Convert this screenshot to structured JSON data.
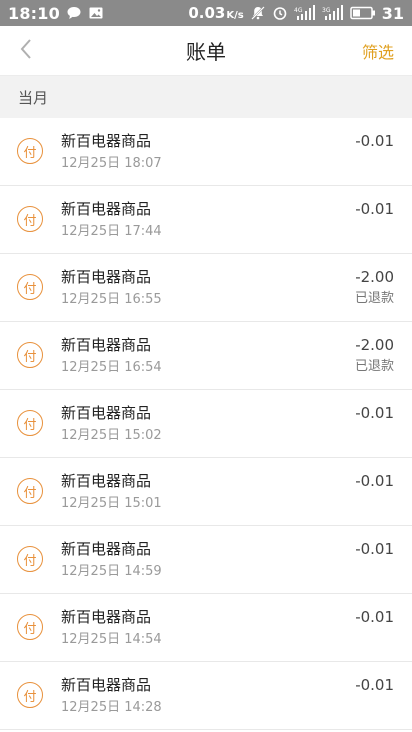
{
  "status_bar": {
    "time": "18:10",
    "net_speed": "0.03",
    "net_speed_unit": "K/s",
    "battery": "31",
    "icons": [
      "chat-bubble-icon",
      "image-icon",
      "mute-bell-icon",
      "alarm-clock-icon",
      "signal-4g-icon",
      "signal-3g-icon",
      "battery-icon"
    ]
  },
  "header": {
    "title": "账单",
    "filter_label": "筛选"
  },
  "section": {
    "label": "当月"
  },
  "accent": "#e8913c",
  "filter_color": "#e0a020",
  "transactions": [
    {
      "icon_char": "付",
      "name": "新百电器商品",
      "time": "12月25日 18:07",
      "amount": "-0.01",
      "status": ""
    },
    {
      "icon_char": "付",
      "name": "新百电器商品",
      "time": "12月25日 17:44",
      "amount": "-0.01",
      "status": ""
    },
    {
      "icon_char": "付",
      "name": "新百电器商品",
      "time": "12月25日 16:55",
      "amount": "-2.00",
      "status": "已退款"
    },
    {
      "icon_char": "付",
      "name": "新百电器商品",
      "time": "12月25日 16:54",
      "amount": "-2.00",
      "status": "已退款"
    },
    {
      "icon_char": "付",
      "name": "新百电器商品",
      "time": "12月25日 15:02",
      "amount": "-0.01",
      "status": ""
    },
    {
      "icon_char": "付",
      "name": "新百电器商品",
      "time": "12月25日 15:01",
      "amount": "-0.01",
      "status": ""
    },
    {
      "icon_char": "付",
      "name": "新百电器商品",
      "time": "12月25日 14:59",
      "amount": "-0.01",
      "status": ""
    },
    {
      "icon_char": "付",
      "name": "新百电器商品",
      "time": "12月25日 14:54",
      "amount": "-0.01",
      "status": ""
    },
    {
      "icon_char": "付",
      "name": "新百电器商品",
      "time": "12月25日 14:28",
      "amount": "-0.01",
      "status": ""
    }
  ]
}
